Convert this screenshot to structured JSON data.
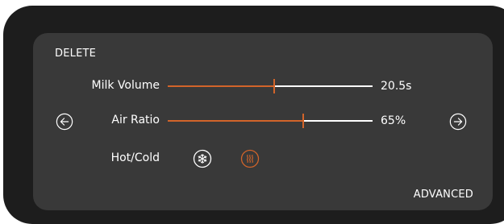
{
  "panel": {
    "delete_label": "DELETE",
    "advanced_label": "ADVANCED"
  },
  "milk_volume": {
    "label": "Milk Volume",
    "value": "20.5s",
    "fill_fraction": 0.52
  },
  "air_ratio": {
    "label": "Air Ratio",
    "value": "65%",
    "fill_fraction": 0.66
  },
  "hot_cold": {
    "label": "Hot/Cold",
    "options": [
      {
        "name": "cold",
        "icon": "snowflake-icon",
        "selected": false
      },
      {
        "name": "hot",
        "icon": "steam-heat-icon",
        "selected": true
      }
    ]
  },
  "navigation": {
    "prev_icon": "arrow-left-circle-icon",
    "next_icon": "arrow-right-circle-icon"
  },
  "colors": {
    "accent": "#d2642a",
    "panel_bg": "#393939",
    "frame_bg": "#1d1d1d",
    "text": "#ffffff"
  }
}
